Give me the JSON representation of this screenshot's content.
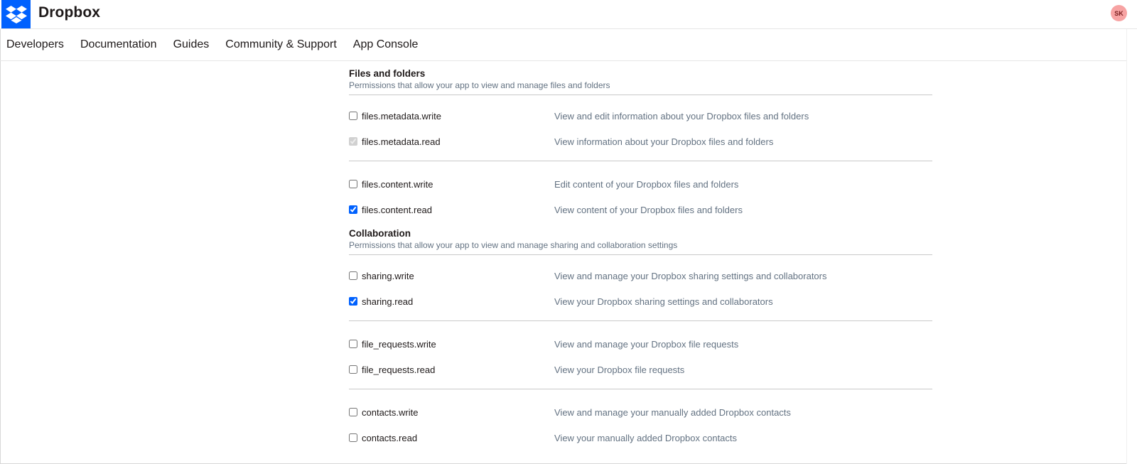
{
  "header": {
    "brand": "Dropbox",
    "avatar_initials": "SK"
  },
  "nav": {
    "items": [
      {
        "label": "Developers"
      },
      {
        "label": "Documentation"
      },
      {
        "label": "Guides"
      },
      {
        "label": "Community & Support"
      },
      {
        "label": "App Console"
      }
    ]
  },
  "sections": [
    {
      "title": "Files and folders",
      "description": "Permissions that allow your app to view and manage files and folders",
      "groups": [
        [
          {
            "name": "files.metadata.write",
            "description": "View and edit information about your Dropbox files and folders",
            "checked": false,
            "disabled": false
          },
          {
            "name": "files.metadata.read",
            "description": "View information about your Dropbox files and folders",
            "checked": true,
            "disabled": true
          }
        ],
        [
          {
            "name": "files.content.write",
            "description": "Edit content of your Dropbox files and folders",
            "checked": false,
            "disabled": false
          },
          {
            "name": "files.content.read",
            "description": "View content of your Dropbox files and folders",
            "checked": true,
            "disabled": false
          }
        ]
      ]
    },
    {
      "title": "Collaboration",
      "description": "Permissions that allow your app to view and manage sharing and collaboration settings",
      "groups": [
        [
          {
            "name": "sharing.write",
            "description": "View and manage your Dropbox sharing settings and collaborators",
            "checked": false,
            "disabled": false
          },
          {
            "name": "sharing.read",
            "description": "View your Dropbox sharing settings and collaborators",
            "checked": true,
            "disabled": false
          }
        ],
        [
          {
            "name": "file_requests.write",
            "description": "View and manage your Dropbox file requests",
            "checked": false,
            "disabled": false
          },
          {
            "name": "file_requests.read",
            "description": "View your Dropbox file requests",
            "checked": false,
            "disabled": false
          }
        ],
        [
          {
            "name": "contacts.write",
            "description": "View and manage your manually added Dropbox contacts",
            "checked": false,
            "disabled": false
          },
          {
            "name": "contacts.read",
            "description": "View your manually added Dropbox contacts",
            "checked": false,
            "disabled": false
          }
        ]
      ]
    }
  ],
  "colors": {
    "brand_blue": "#0061fe",
    "avatar_bg": "#f7a3a3",
    "muted_text": "#637282"
  }
}
